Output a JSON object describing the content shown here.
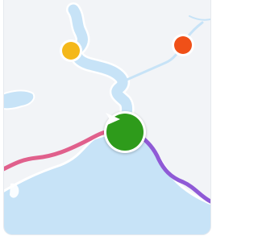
{
  "map": {
    "colors": {
      "background": "#f2f4f7",
      "water": "#c7e3f7",
      "water_edge": "#ffffff",
      "route_pink": "#e0608c",
      "route_purple": "#8f5ad6",
      "nav_button": "#2e9b1b",
      "pin_yellow": "#f4b81a",
      "pin_orange": "#f05018"
    },
    "markers": [
      {
        "name": "yellow-location-pin",
        "color": "#f4b81a"
      },
      {
        "name": "orange-location-pin",
        "color": "#f05018"
      }
    ],
    "nav_button": {
      "icon": "arrow-right-icon",
      "color": "#2e9b1b"
    }
  }
}
